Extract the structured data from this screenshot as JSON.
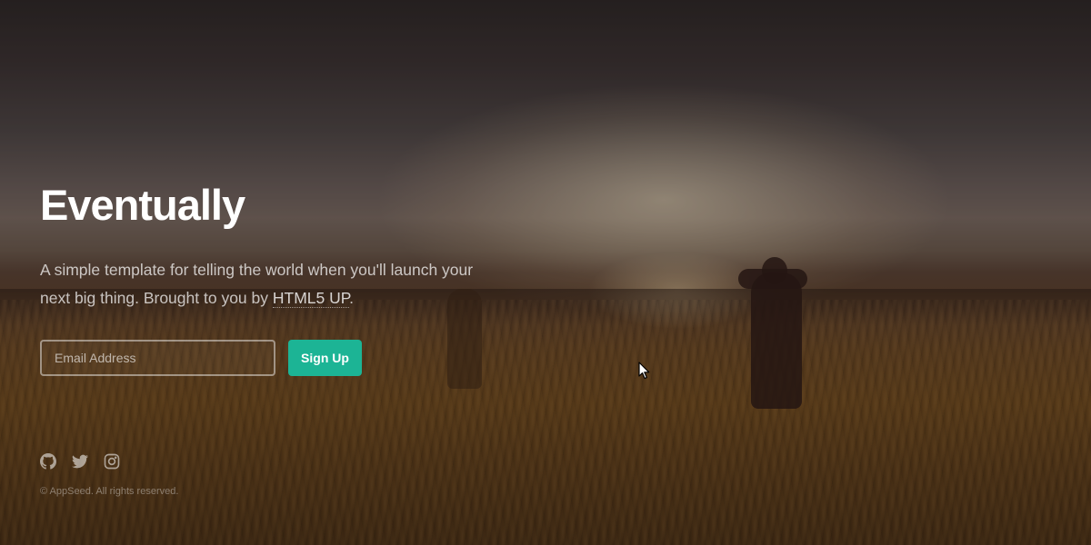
{
  "hero": {
    "title": "Eventually",
    "subtitle_text": "A simple template for telling the world when you'll launch your next big thing. Brought to you by ",
    "subtitle_link": "HTML5 UP",
    "subtitle_end": "."
  },
  "signup_form": {
    "email_placeholder": "Email Address",
    "email_value": "",
    "submit_label": "Sign Up",
    "accent_color": "#1cb495"
  },
  "social_links": [
    {
      "icon": "github-icon"
    },
    {
      "icon": "twitter-icon"
    },
    {
      "icon": "instagram-icon"
    }
  ],
  "footer": {
    "copyright": "© AppSeed. All rights reserved."
  }
}
